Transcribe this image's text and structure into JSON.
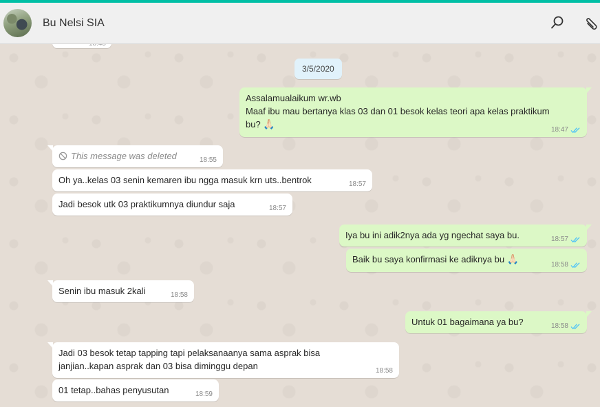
{
  "header": {
    "contact_name": "Bu Nelsi SIA",
    "search_icon": "search-icon",
    "attach_icon": "paperclip-icon"
  },
  "chat": {
    "date_chip": "3/5/2020",
    "colors": {
      "incoming": "#ffffff",
      "outgoing": "#dcf8c6",
      "read_ticks": "#4fc3f7",
      "accent": "#00bfa5"
    },
    "messages": [
      {
        "dir": "out",
        "text_lines": [
          "Assalamualaikum wr.wb",
          "Maaf ibu mau bertanya klas 03 dan 01 besok kelas teori apa kelas praktikum",
          "bu?"
        ],
        "emoji": "🙏🏻",
        "time": "18:47",
        "status": "read"
      },
      {
        "dir": "in",
        "deleted": true,
        "text": "This message was deleted",
        "time": "18:55"
      },
      {
        "dir": "in",
        "text": "Oh ya..kelas 03 senin kemaren ibu ngga masuk krn uts..bentrok",
        "time": "18:57"
      },
      {
        "dir": "in",
        "text": "Jadi besok utk 03 praktikumnya diundur saja",
        "time": "18:57"
      },
      {
        "dir": "out",
        "text": "Iya bu ini adik2nya ada yg ngechat saya bu.",
        "time": "18:57",
        "status": "read"
      },
      {
        "dir": "out",
        "text": "Baik bu saya konfirmasi ke adiknya bu",
        "emoji": "🙏🏻",
        "time": "18:58",
        "status": "read"
      },
      {
        "dir": "in",
        "text": "Senin ibu masuk 2kali",
        "time": "18:58"
      },
      {
        "dir": "out",
        "text": "Untuk 01 bagaimana ya bu?",
        "time": "18:58",
        "status": "read"
      },
      {
        "dir": "in",
        "text_lines": [
          "Jadi 03 besok tetap tapping tapi pelaksanaanya sama asprak bisa",
          "janjian..kapan asprak dan 03 bisa diminggu depan"
        ],
        "time": "18:58"
      },
      {
        "dir": "in",
        "text": "01 tetap..bahas penyusutan",
        "time": "18:59"
      }
    ]
  }
}
